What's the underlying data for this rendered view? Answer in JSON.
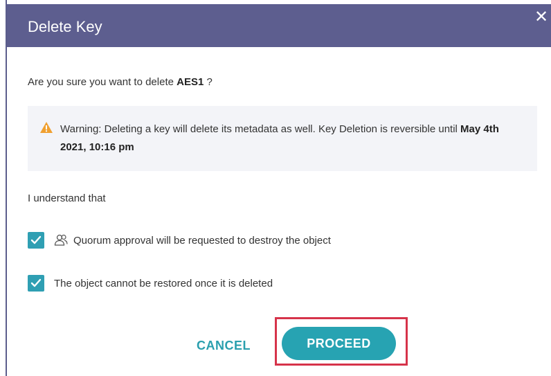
{
  "dialog": {
    "title": "Delete Key",
    "close_symbol": "✕",
    "question_prefix": "Are you sure you want to delete",
    "key_name": "AES1",
    "question_suffix": "?",
    "warning_icon": "warning-triangle-icon",
    "warning_text": "Warning: Deleting a key will delete its metadata as well. Key Deletion is reversible until",
    "warning_date": "May 4th 2021, 10:16 pm",
    "understand_label": "I understand that",
    "checkboxes": [
      {
        "label": "Quorum approval will be requested to destroy the object",
        "checked": true,
        "icon": "group-icon"
      },
      {
        "label": "The object cannot be restored once it is deleted",
        "checked": true
      }
    ],
    "cancel_label": "CANCEL",
    "proceed_label": "PROCEED"
  },
  "colors": {
    "header_bg": "#5d5e8f",
    "accent": "#27a3b2",
    "checkbox": "#2f9fb3",
    "warning_bg": "#f3f4f8",
    "warning_icon": "#f0a030",
    "highlight_border": "#d6334a"
  }
}
